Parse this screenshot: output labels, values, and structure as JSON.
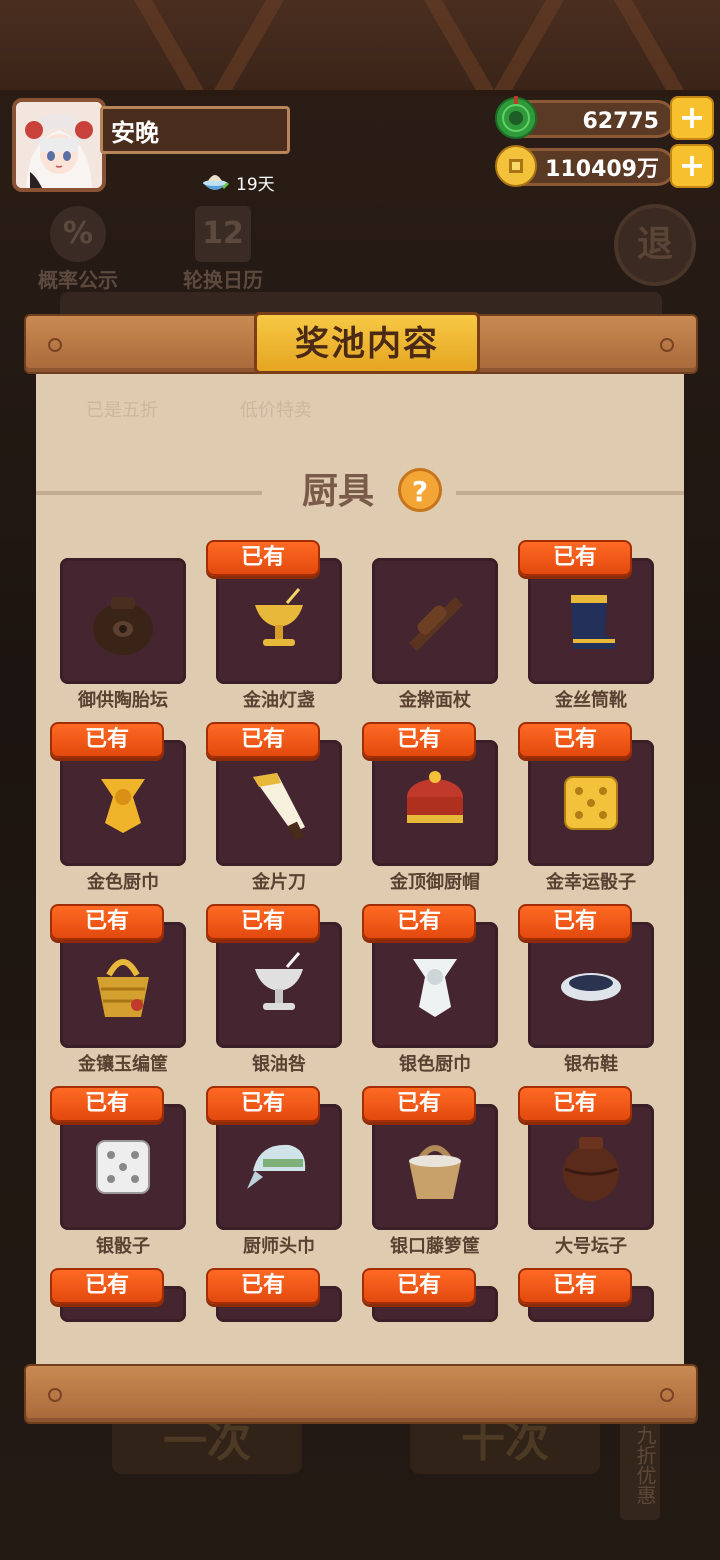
{
  "profile": {
    "name": "安晚",
    "days": "19天"
  },
  "currencies": {
    "jade": "62775",
    "coins": "110409万"
  },
  "background": {
    "probability_label": "概率公示",
    "probability_symbol": "%",
    "rotation_label": "轮换日历",
    "rotation_symbol": "12",
    "exit_label": "退",
    "btn_single": "一次",
    "btn_ten": "十次",
    "side_badge": "九折优惠"
  },
  "modal": {
    "title": "奖池内容",
    "section_title": "厨具",
    "help_symbol": "?",
    "faded_row": [
      "已是五折",
      "低价特卖"
    ],
    "owned_badge": "已有"
  },
  "items": [
    {
      "name": "御供陶胎坛",
      "owned": false,
      "icon": "jar-icon"
    },
    {
      "name": "金油灯盏",
      "owned": true,
      "icon": "golden-lamp-icon"
    },
    {
      "name": "金擀面杖",
      "owned": false,
      "icon": "rolling-pin-icon"
    },
    {
      "name": "金丝筒靴",
      "owned": true,
      "icon": "boot-icon"
    },
    {
      "name": "金色厨巾",
      "owned": true,
      "icon": "gold-scarf-icon"
    },
    {
      "name": "金片刀",
      "owned": true,
      "icon": "knife-icon"
    },
    {
      "name": "金顶御厨帽",
      "owned": true,
      "icon": "chef-hat-icon"
    },
    {
      "name": "金幸运骰子",
      "owned": true,
      "icon": "gold-dice-icon"
    },
    {
      "name": "金镶玉编筐",
      "owned": true,
      "icon": "gold-basket-icon"
    },
    {
      "name": "银油咎",
      "owned": true,
      "icon": "silver-lamp-icon"
    },
    {
      "name": "银色厨巾",
      "owned": true,
      "icon": "silver-scarf-icon"
    },
    {
      "name": "银布鞋",
      "owned": true,
      "icon": "cloth-shoe-icon"
    },
    {
      "name": "银骰子",
      "owned": true,
      "icon": "silver-dice-icon"
    },
    {
      "name": "厨师头巾",
      "owned": true,
      "icon": "headscarf-icon"
    },
    {
      "name": "银口藤箩筐",
      "owned": true,
      "icon": "rattan-basket-icon"
    },
    {
      "name": "大号坛子",
      "owned": true,
      "icon": "big-jar-icon"
    },
    {
      "name": "",
      "owned": true,
      "icon": "partial-item-icon"
    },
    {
      "name": "",
      "owned": true,
      "icon": "partial-item-icon"
    },
    {
      "name": "",
      "owned": true,
      "icon": "partial-item-icon"
    },
    {
      "name": "",
      "owned": true,
      "icon": "partial-item-icon"
    }
  ]
}
